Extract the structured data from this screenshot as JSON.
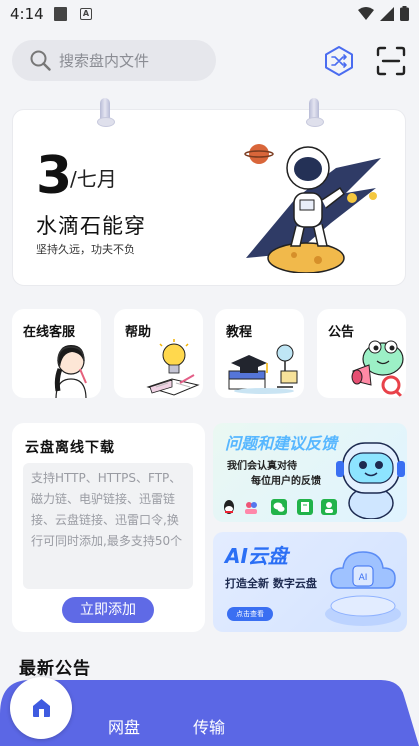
{
  "status_bar": {
    "time": "4:14"
  },
  "search": {
    "placeholder": "搜索盘内文件"
  },
  "calendar": {
    "day": "3",
    "month": "/七月",
    "headline": "水滴石能穿",
    "subline": "坚持久远，功夫不负"
  },
  "tiles": [
    {
      "label": "在线客服"
    },
    {
      "label": "帮助"
    },
    {
      "label": "教程"
    },
    {
      "label": "公告"
    }
  ],
  "offline_download": {
    "title": "云盘离线下载",
    "description": "支持HTTP、HTTPS、FTP、磁力链、电驴链接、迅雷链接、云盘链接、迅雷口令,换行可同时添加,最多支持50个",
    "button": "立即添加"
  },
  "feedback_banner": {
    "title": "问题和建议反馈",
    "line1": "我们会认真对待",
    "line2": "每位用户的反馈"
  },
  "ai_banner": {
    "title": "AI云盘",
    "subtitle": "打造全新 数字云盘",
    "cta": "点击查看"
  },
  "news": {
    "title": "最新公告"
  },
  "bottom_nav": {
    "items": [
      "网盘",
      "传输"
    ]
  },
  "colors": {
    "accent": "#5f6ae6",
    "nav": "#5b67e5",
    "background": "#f3f4f7"
  }
}
